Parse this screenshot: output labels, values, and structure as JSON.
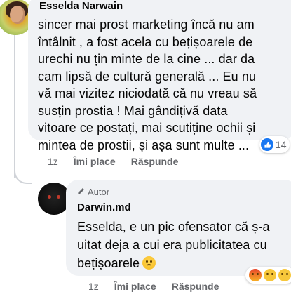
{
  "comment": {
    "author": "Esselda Narwain",
    "text_lines": [
      "sincer mai prost marketing încă nu am",
      "întâlnit , a fost acela cu bețișoarele de",
      "urechi nu țin minte de la cine ... dar da",
      "cam lipsă de cultură generală ... Eu nu",
      "vă mai vizitez niciodată că nu vreau să",
      "susțin prostia ! Mai gândițivă data",
      "vitoare ce postați, mai scutiține ochii și",
      "mintea de prostii, și așa sunt multe ..."
    ],
    "reaction_count": "14",
    "time": "1z",
    "like_label": "Îmi place",
    "reply_label": "Răspunde"
  },
  "reply": {
    "badge_label": "Autor",
    "author": "Darwin.md",
    "text_lines": [
      "Esselda, e un pic ofensator că ș-a",
      "uitat deja a cui era publicitatea cu",
      "bețișoarele"
    ],
    "time": "1z",
    "like_label": "Îmi place",
    "reply_label": "Răspunde"
  },
  "icons": {
    "comment_avatar": "profile-photo-avatar",
    "reply_avatar": "brand-logo-avatar",
    "like_reaction": "thumbs-up-icon",
    "author_badge": "pencil-icon",
    "sad_emoji": "sad-face-emoji",
    "reply_reactions": [
      "angry-reaction-icon",
      "sad-reaction-icon",
      "haha-reaction-icon"
    ]
  },
  "colors": {
    "bubble": "#f0f2f5",
    "like_blue": "#1877f2",
    "meta_gray": "#65676b"
  }
}
